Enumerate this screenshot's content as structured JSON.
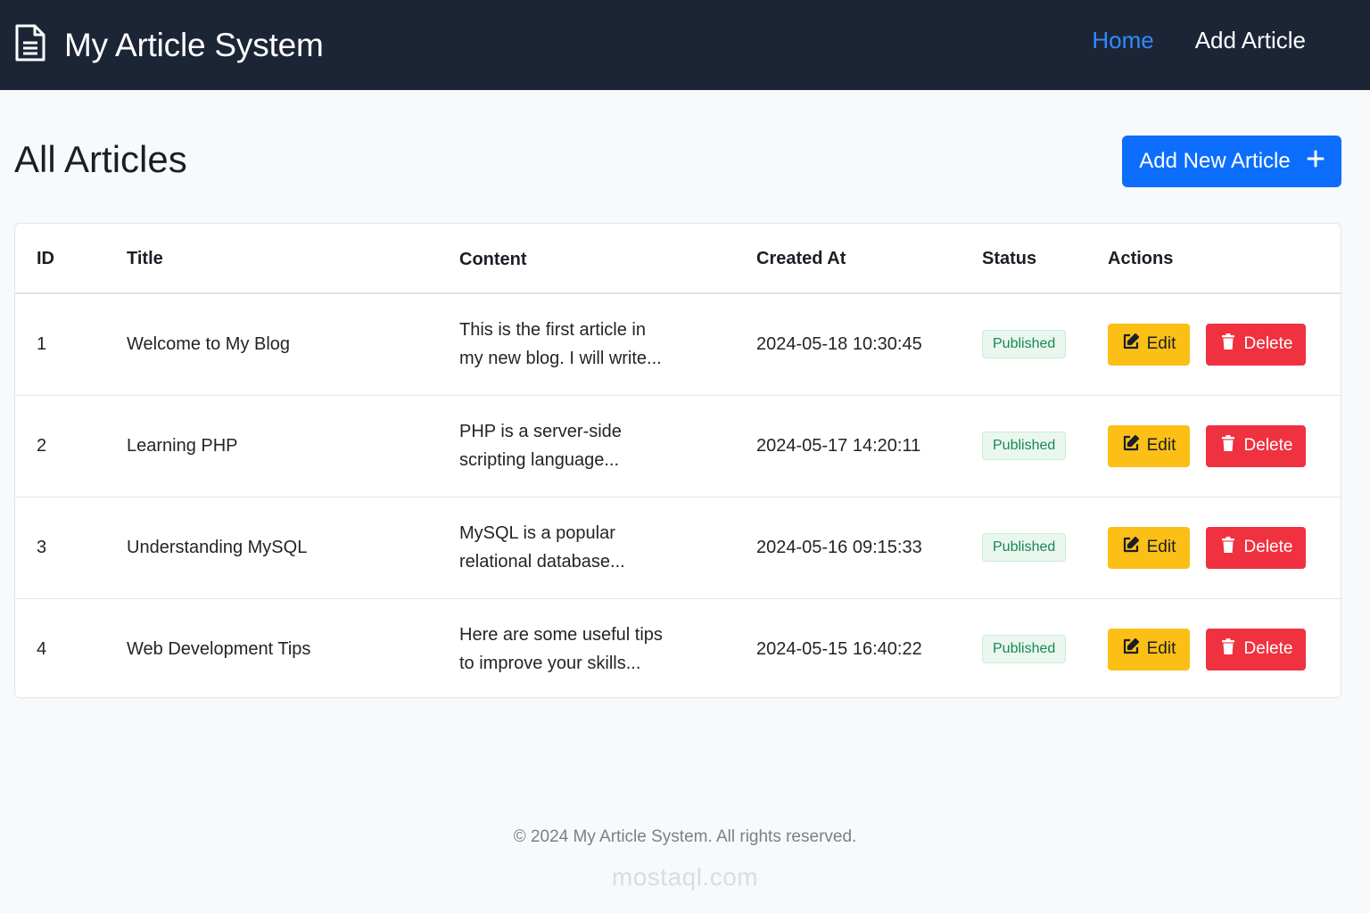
{
  "navbar": {
    "brand": "My Article System",
    "links": [
      {
        "label": "Home",
        "active": true
      },
      {
        "label": "Add Article",
        "active": false
      }
    ]
  },
  "page": {
    "title": "All Articles",
    "add_button": "Add New Article"
  },
  "table": {
    "headers": {
      "id": "ID",
      "title": "Title",
      "content": "Content",
      "created_at": "Created At",
      "status": "Status",
      "actions": "Actions"
    },
    "edit_label": "Edit",
    "delete_label": "Delete",
    "rows": [
      {
        "id": "1",
        "title": "Welcome to My Blog",
        "content": "This is the first article in my new blog. I will write...",
        "created_at": "2024-05-18 10:30:45",
        "status": "Published"
      },
      {
        "id": "2",
        "title": "Learning PHP",
        "content": "PHP is a server-side scripting language...",
        "created_at": "2024-05-17 14:20:11",
        "status": "Published"
      },
      {
        "id": "3",
        "title": "Understanding MySQL",
        "content": "MySQL is a popular relational database...",
        "created_at": "2024-05-16 09:15:33",
        "status": "Published"
      },
      {
        "id": "4",
        "title": "Web Development Tips",
        "content": "Here are some useful tips to improve your skills...",
        "created_at": "2024-05-15 16:40:22",
        "status": "Published"
      }
    ]
  },
  "footer": {
    "text": "© 2024 My Article System. All rights reserved.",
    "watermark": "mostaql.com"
  },
  "colors": {
    "navbar": "#1c2536",
    "primary": "#0d6efd",
    "edit": "#fbbf16",
    "delete": "#f0313f",
    "published": "#198754"
  },
  "icons": {
    "brand": "document-icon",
    "add": "plus-icon",
    "edit": "edit-icon",
    "delete": "trash-icon"
  }
}
